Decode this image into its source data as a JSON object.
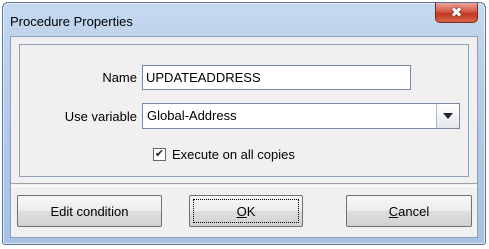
{
  "window": {
    "title": "Procedure Properties",
    "close_glyph": "✖"
  },
  "form": {
    "name_label": "Name",
    "name_value": "UPDATEADDRESS",
    "variable_label": "Use variable",
    "variable_value": "Global-Address",
    "execute_label": "Execute on all copies",
    "execute_checked": true,
    "check_glyph": "✔"
  },
  "buttons": {
    "edit_condition": "Edit condition",
    "ok_underlined": "O",
    "ok_rest": "K",
    "cancel_underlined": "C",
    "cancel_rest": "ancel"
  }
}
